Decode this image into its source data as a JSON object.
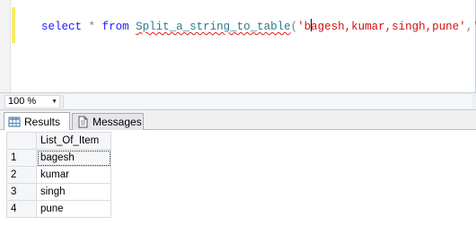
{
  "editor": {
    "keyword_select": "select",
    "star": "*",
    "keyword_from": "from",
    "function_name": "Split_a_string_to_table",
    "open_paren": "(",
    "string_part1": "'b",
    "string_part2": "agesh,kumar,singh,pune'",
    "comma": ",",
    "separator_literal": "','",
    "close_paren": ")"
  },
  "zoom": {
    "value": "100 %"
  },
  "tabs": {
    "results_label": "Results",
    "messages_label": "Messages"
  },
  "grid": {
    "column_header": "List_Of_Item",
    "rows": [
      {
        "num": "1",
        "value": "bagesh"
      },
      {
        "num": "2",
        "value": "kumar"
      },
      {
        "num": "3",
        "value": "singh"
      },
      {
        "num": "4",
        "value": "pune"
      }
    ]
  },
  "colors": {
    "keyword": "#1a1aff",
    "function": "#2b7a8a",
    "string": "#d21010",
    "change_marker": "#f6ec6a"
  },
  "icons": {
    "results_tab": "grid-icon",
    "messages_tab": "document-icon",
    "zoom_dropdown": "dropdown-arrow-icon"
  }
}
